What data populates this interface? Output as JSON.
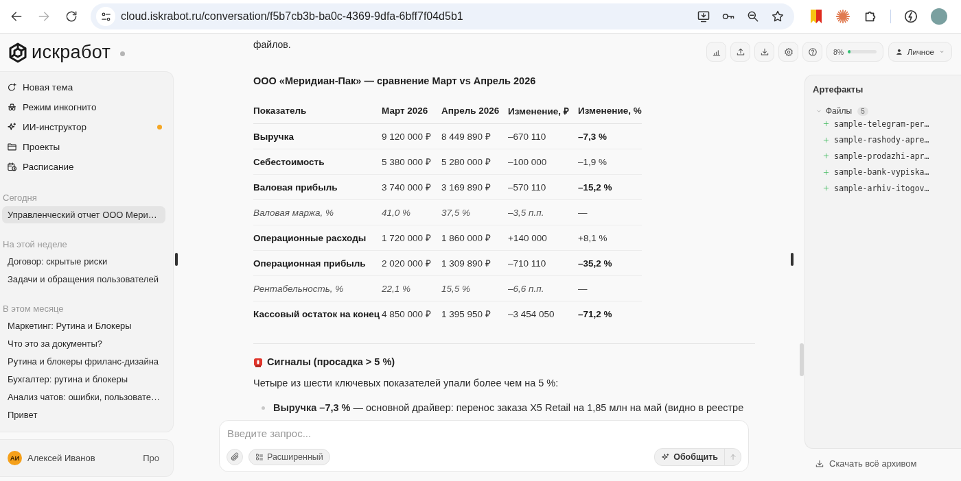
{
  "browser": {
    "url": "cloud.iskrabot.ru/conversation/f5b7cb3b-ba0c-4369-9dfa-6bff7f04d5b1",
    "forward_disabled": true
  },
  "app": {
    "logo": "искработ"
  },
  "sidebar": {
    "nav": [
      {
        "kind": "new",
        "label": "Новая тема",
        "dot": false
      },
      {
        "kind": "incognito",
        "label": "Режим инкогнито",
        "dot": false
      },
      {
        "kind": "sparkle",
        "label": "ИИ-инструктор",
        "dot": true
      },
      {
        "kind": "folder",
        "label": "Проекты",
        "dot": false
      },
      {
        "kind": "schedule",
        "label": "Расписание",
        "dot": false
      }
    ],
    "sections": [
      {
        "title": "Сегодня",
        "items": [
          {
            "label": "Управленческий отчет ООО Мери…",
            "selected": true
          }
        ]
      },
      {
        "title": "На этой неделе",
        "items": [
          {
            "label": "Договор: скрытые риски",
            "selected": false
          },
          {
            "label": "Задачи и обращения пользователей",
            "selected": false
          }
        ]
      },
      {
        "title": "В этом месяце",
        "items": [
          {
            "label": "Маркетинг: Рутина и Блокеры",
            "selected": false
          },
          {
            "label": "Что это за документы?",
            "selected": false
          },
          {
            "label": "Рутина и блокеры фриланс-дизайна",
            "selected": false
          },
          {
            "label": "Бухгалтер: рутина и блокеры",
            "selected": false
          },
          {
            "label": "Анализ чатов: ошибки, пользовате…",
            "selected": false
          },
          {
            "label": "Привет",
            "selected": false
          }
        ]
      }
    ],
    "user": {
      "initials": "АИ",
      "name": "Алексей Иванов",
      "plan": "Про"
    }
  },
  "toolbar": {
    "usage": {
      "reading": "8%",
      "level": 0.08
    },
    "profile": "Личное"
  },
  "message": {
    "lead": "файлов.",
    "table_title": "ООО «Меридиан-Пак» — сравнение Март vs Апрель 2026",
    "columns": [
      "Показатель",
      "Март 2026",
      "Апрель 2026",
      "Изменение, ₽",
      "Изменение, %"
    ],
    "rows": [
      {
        "kind": "metric",
        "highlight": true,
        "cells": [
          "Выручка",
          "9 120 000 ₽",
          "8 449 890 ₽",
          "–670 110",
          "–7,3 %"
        ]
      },
      {
        "kind": "metric",
        "highlight": false,
        "cells": [
          "Себестоимость",
          "5 380 000 ₽",
          "5 280 000 ₽",
          "–100 000",
          "–1,9 %"
        ]
      },
      {
        "kind": "metric",
        "highlight": true,
        "cells": [
          "Валовая прибыль",
          "3 740 000 ₽",
          "3 169 890 ₽",
          "–570 110",
          "–15,2 %"
        ]
      },
      {
        "kind": "ratio",
        "highlight": false,
        "cells": [
          "Валовая маржа, %",
          "41,0 %",
          "37,5 %",
          "–3,5 п.п.",
          "—"
        ]
      },
      {
        "kind": "metric",
        "highlight": false,
        "cells": [
          "Операционные расходы",
          "1 720 000 ₽",
          "1 860 000 ₽",
          "+140 000",
          "+8,1 %"
        ]
      },
      {
        "kind": "metric",
        "highlight": true,
        "cells": [
          "Операционная прибыль",
          "2 020 000 ₽",
          "1 309 890 ₽",
          "–710 110",
          "–35,2 %"
        ]
      },
      {
        "kind": "ratio",
        "highlight": false,
        "cells": [
          "Рентабельность, %",
          "22,1 %",
          "15,5 %",
          "–6,6 п.п.",
          "—"
        ]
      },
      {
        "kind": "metric",
        "highlight": true,
        "cells": [
          "Кассовый остаток на конец",
          "4 850 000 ₽",
          "1 395 950 ₽",
          "–3 454 050",
          "–71,2 %"
        ]
      }
    ],
    "signals_title": "Сигналы (просадка > 5 %)",
    "intro": "Четыре из шести ключевых показателей упали более чем на 5 %:",
    "bullets": [
      "**Выручка –7,3 %** — основной драйвер: перенос заказа X5 Retail на 1,85 млн на май (видно в реестре"
    ]
  },
  "composer": {
    "placeholder": "Введите запрос...",
    "mode": "Расширенный",
    "summarize": "Обобщить"
  },
  "artifacts": {
    "title": "Артефакты",
    "group": {
      "label": "Файлы",
      "count": "5",
      "expanded": true,
      "files": [
        "sample-telegram-per…",
        "sample-rashody-apre…",
        "sample-prodazhi-apr…",
        "sample-bank-vypiska…",
        "sample-arhiv-itogov…"
      ]
    },
    "download": "Скачать всё архивом"
  }
}
